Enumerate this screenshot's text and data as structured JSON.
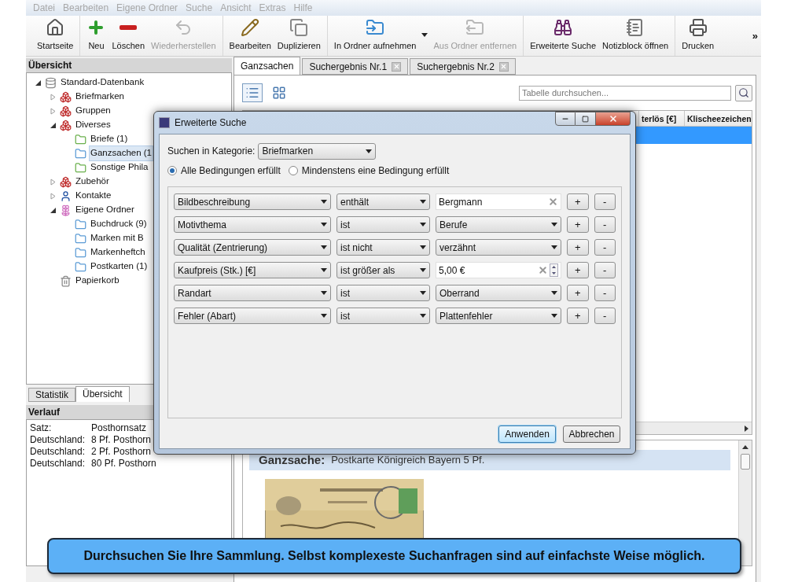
{
  "menu": [
    {
      "label": "Datei",
      "disabled": true
    },
    {
      "label": "Bearbeiten",
      "disabled": true
    },
    {
      "label": "Eigene Ordner",
      "disabled": true
    },
    {
      "label": "Suche",
      "disabled": true
    },
    {
      "label": "Ansicht",
      "disabled": true
    },
    {
      "label": "Extras",
      "disabled": true
    },
    {
      "label": "Hilfe",
      "disabled": true
    }
  ],
  "toolbar": [
    [
      {
        "label": "Startseite",
        "kind": "home",
        "disabled": false
      }
    ],
    [
      {
        "label": "Neu",
        "kind": "add",
        "disabled": false
      },
      {
        "label": "Löschen",
        "kind": "remove",
        "disabled": false
      },
      {
        "label": "Wiederherstellen",
        "kind": "restore",
        "disabled": true
      }
    ],
    [
      {
        "label": "Bearbeiten",
        "kind": "edit",
        "disabled": false
      },
      {
        "label": "Duplizieren",
        "kind": "duplicate",
        "disabled": false
      }
    ],
    [
      {
        "label": "In Ordner aufnehmen",
        "kind": "folder_in",
        "disabled": false,
        "dropdown": true
      },
      {
        "label": "Aus Ordner entfernen",
        "kind": "folder_out",
        "disabled": true
      }
    ],
    [
      {
        "label": "Erweiterte Suche",
        "kind": "binoculars",
        "disabled": false
      },
      {
        "label": "Notizblock öffnen",
        "kind": "notepad",
        "disabled": false
      }
    ],
    [
      {
        "label": "Drucken",
        "kind": "print",
        "disabled": false
      }
    ]
  ],
  "toolbar_overflow": "»",
  "sidebar": {
    "title": "Übersicht",
    "tree": [
      {
        "label": "Standard-Datenbank",
        "kind": "database",
        "expanded": true,
        "children": [
          {
            "label": "Briefmarken",
            "kind": "blocks",
            "expanded": false
          },
          {
            "label": "Gruppen",
            "kind": "blocks",
            "expanded": false
          },
          {
            "label": "Diverses",
            "kind": "blocks",
            "expanded": true,
            "children": [
              {
                "label": "Briefe (1)",
                "kind": "folder_green",
                "selected": false
              },
              {
                "label": "Ganzsachen (1",
                "kind": "folder_blue",
                "selected": true
              },
              {
                "label": "Sonstige Phila",
                "kind": "folder_green",
                "selected": false
              }
            ]
          },
          {
            "label": "Zubehör",
            "kind": "blocks",
            "expanded": false
          },
          {
            "label": "Kontakte",
            "kind": "person",
            "expanded": false
          },
          {
            "label": "Eigene Ordner",
            "kind": "flower",
            "expanded": true,
            "children": [
              {
                "label": "Buchdruck (9)",
                "kind": "folder_blue",
                "selected": false
              },
              {
                "label": "Marken mit B",
                "kind": "folder_blue",
                "selected": false
              },
              {
                "label": "Markenheftch",
                "kind": "folder_blue",
                "selected": false
              },
              {
                "label": "Postkarten (1)",
                "kind": "folder_blue",
                "selected": false
              }
            ]
          },
          {
            "label": "Papierkorb",
            "kind": "trash"
          }
        ]
      }
    ]
  },
  "bottom_tabs": [
    {
      "label": "Statistik",
      "selected": false
    },
    {
      "label": "Übersicht",
      "selected": true
    }
  ],
  "history": {
    "title": "Verlauf",
    "rows": [
      {
        "col_1": "Satz:",
        "col_2": "Posthornsatz"
      },
      {
        "col_1": "Deutschland:",
        "col_2": "8 Pf. Posthorn"
      },
      {
        "col_1": "Deutschland:",
        "col_2": "2 Pf. Posthorn"
      },
      {
        "col_1": "Deutschland:",
        "col_2": "80 Pf. Posthorn"
      }
    ]
  },
  "tabs": [
    {
      "label": "Ganzsachen",
      "selected": true,
      "closable": false
    },
    {
      "label": "Suchergebnis Nr.1",
      "selected": false,
      "closable": true
    },
    {
      "label": "Suchergebnis Nr.2",
      "selected": false,
      "closable": true
    }
  ],
  "view_buttons": [
    {
      "kind": "list",
      "selected": true
    },
    {
      "kind": "grid",
      "selected": false
    }
  ],
  "search": {
    "placeholder": "Tabelle durchsuchen..."
  },
  "table": {
    "columns": [
      "terlös [€]",
      "Klischeezeichen"
    ],
    "rows": [
      {
        "selected": true
      }
    ]
  },
  "detail": {
    "label": "Ganzsache:",
    "title": "Postkarte Königreich Bayern 5 Pf.",
    "kind": "picture"
  },
  "dialog": {
    "title": "Erweiterte Suche",
    "category_label": "Suchen in Kategorie:",
    "category": "Briefmarken",
    "match_options": [
      {
        "label": "Alle Bedingungen erfüllt",
        "selected": true
      },
      {
        "label": "Mindenstens eine Bedingung erfüllt",
        "selected": false
      }
    ],
    "conditions": [
      {
        "field": "Bildbeschreibung",
        "operator": "enthält",
        "value": "Bergmann",
        "kind": "text",
        "add": "+",
        "remove": "-"
      },
      {
        "field": "Motivthema",
        "operator": "ist",
        "value": "Berufe",
        "kind": "select",
        "add": "+",
        "remove": "-"
      },
      {
        "field": "Qualität (Zentrierung)",
        "operator": "ist nicht",
        "value": "verzähnt",
        "kind": "select",
        "add": "+",
        "remove": "-"
      },
      {
        "field": "Kaufpreis (Stk.) [€]",
        "operator": "ist größer als",
        "value": "5,00 €",
        "kind": "number",
        "add": "+",
        "remove": "-"
      },
      {
        "field": "Randart",
        "operator": "ist",
        "value": "Oberrand",
        "kind": "select",
        "add": "+",
        "remove": "-"
      },
      {
        "field": "Fehler (Abart)",
        "operator": "ist",
        "value": "Plattenfehler",
        "kind": "select",
        "add": "+",
        "remove": "-"
      }
    ],
    "buttons": [
      {
        "label": "Anwenden",
        "default": true
      },
      {
        "label": "Abbrechen",
        "default": false
      }
    ]
  },
  "banner": "Durchsuchen Sie Ihre Sammlung. Selbst komplexeste Suchanfragen sind auf einfachste Weise möglich."
}
